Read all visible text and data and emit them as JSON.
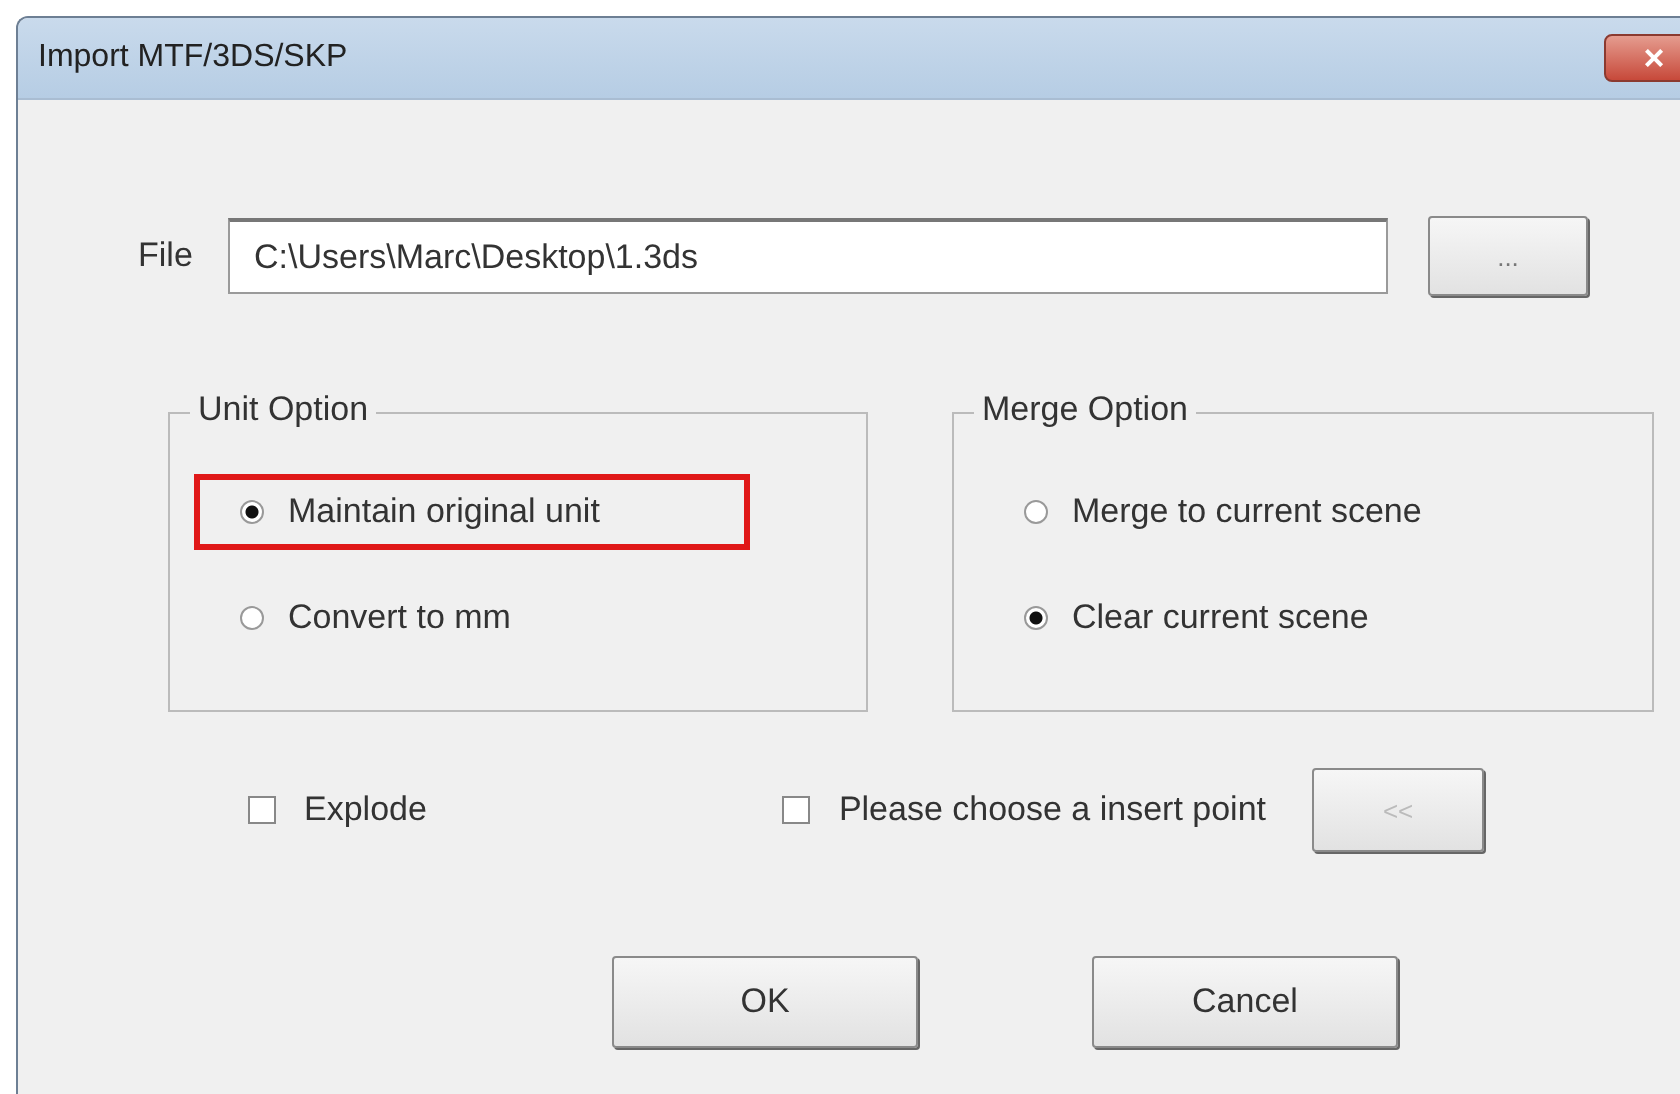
{
  "window": {
    "title": "Import MTF/3DS/SKP",
    "close": "×"
  },
  "file": {
    "label": "File",
    "value": "C:\\Users\\Marc\\Desktop\\1.3ds",
    "browse": "..."
  },
  "groups": [
    {
      "title": "Unit Option",
      "options": [
        {
          "label": "Maintain original unit",
          "selected": true,
          "highlighted": true
        },
        {
          "label": "Convert to mm",
          "selected": false,
          "highlighted": false
        }
      ]
    },
    {
      "title": "Merge Option",
      "options": [
        {
          "label": "Merge to current scene",
          "selected": false,
          "highlighted": false
        },
        {
          "label": "Clear current scene",
          "selected": true,
          "highlighted": false
        }
      ]
    }
  ],
  "explode": {
    "label": "Explode",
    "checked": false
  },
  "insert_point": {
    "label": "Please choose a insert point",
    "checked": false
  },
  "insert_button": {
    "label": "<<",
    "disabled": true
  },
  "buttons": [
    "OK",
    "Cancel"
  ]
}
